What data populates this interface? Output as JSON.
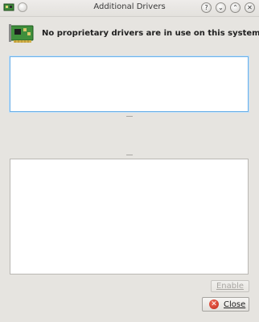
{
  "window": {
    "title": "Additional Drivers",
    "controls": {
      "help": "?",
      "minimize": "⌄",
      "maximize": "⌃",
      "close": "✕"
    }
  },
  "header": {
    "icon": "expansion-card-icon",
    "message": "No proprietary drivers are in use on this system."
  },
  "driver_list": {
    "items": []
  },
  "details_list": {
    "items": []
  },
  "actions": {
    "enable_label": "Enable",
    "close_label": "Close",
    "close_icon": "close-icon"
  },
  "colors": {
    "focus_border": "#6fb0e6",
    "close_icon": "#d13a27"
  }
}
